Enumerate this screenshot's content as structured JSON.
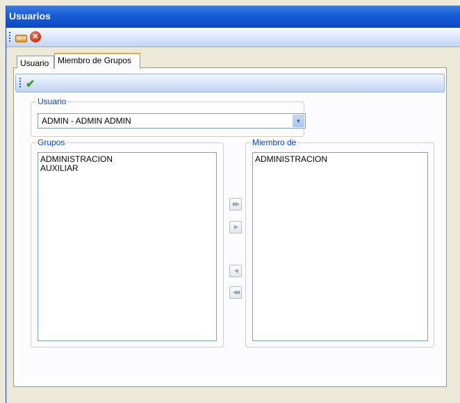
{
  "window": {
    "title": "Usuarios"
  },
  "toolbar": {
    "new_label": "NEW",
    "close_glyph": "✕"
  },
  "tabs": [
    {
      "label": "Usuario",
      "active": false
    },
    {
      "label": "Miembro de Grupos",
      "active": true
    }
  ],
  "usuario": {
    "legend": "Usuario",
    "selected": "ADMIN - ADMIN ADMIN"
  },
  "grupos": {
    "legend": "Grupos",
    "items": [
      "ADMINISTRACION",
      "AUXILIAR"
    ]
  },
  "miembro": {
    "legend": "Miembro de",
    "items": [
      "ADMINISTRACION"
    ]
  },
  "icons": {
    "new": "new-icon",
    "close": "close-icon",
    "save": "check-icon",
    "move_all_right": "double-right-arrow-icon",
    "move_right": "right-arrow-icon",
    "move_left": "left-arrow-icon",
    "move_all_left": "double-left-arrow-icon"
  },
  "colors": {
    "title_bar": "#0b49c4",
    "legend_text": "#0046d5",
    "active_tab_accent": "#f0a63c"
  }
}
